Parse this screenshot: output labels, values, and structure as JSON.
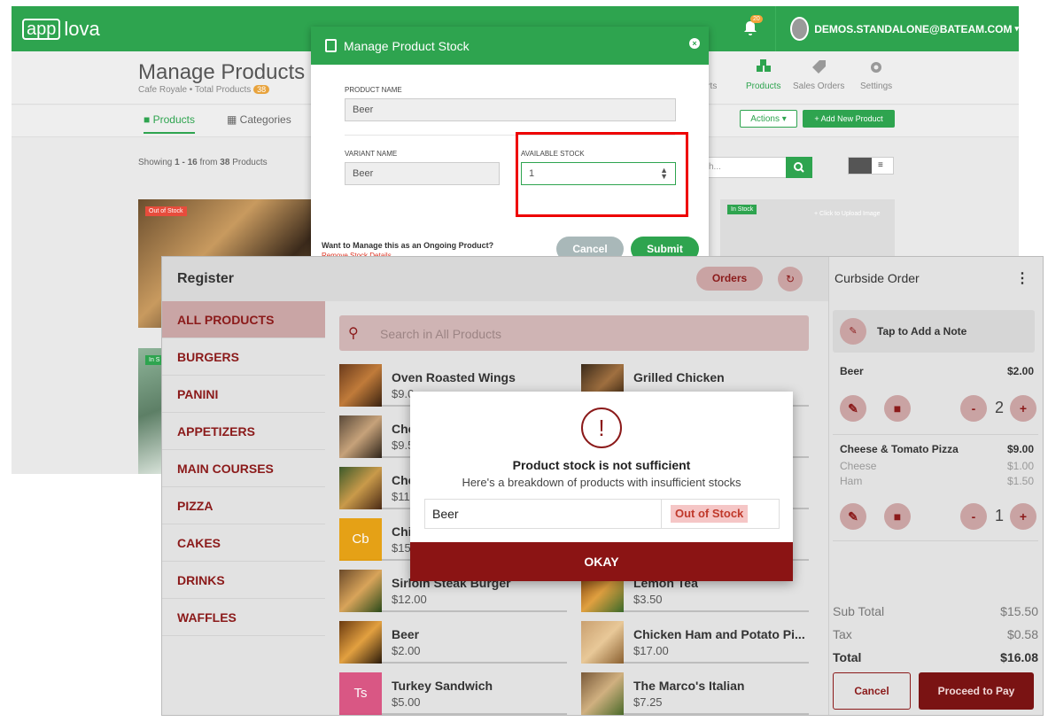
{
  "admin": {
    "logo_box": "app",
    "logo_text": "lova",
    "notif_count": "20",
    "user_email": "DEMOS.STANDALONE@BATEAM.COM",
    "user_caret": "▾",
    "page_title": "Manage Products",
    "page_sub": "Cafe Royale • Total Products",
    "total_products": "38",
    "nav": [
      "orts",
      "Products",
      "Sales Orders",
      "Settings"
    ],
    "tabs": {
      "products": "Products",
      "categories": "Categories"
    },
    "actions_label": "Actions ▾",
    "add_label": "+ Add New Product",
    "showing_pre": "Showing",
    "showing_range": "1 - 16",
    "showing_mid": "from",
    "showing_count": "38",
    "showing_post": "Products",
    "search_placeholder": "ch...",
    "out_of_stock": "Out of Stock",
    "in_stock": "In Stock",
    "in_stock_2": "In S",
    "upload": "+ Click to Upload Image"
  },
  "stock_modal": {
    "title": "Manage Product Stock",
    "product_name_label": "PRODUCT NAME",
    "product_name_value": "Beer",
    "variant_name_label": "VARIANT NAME",
    "variant_name_value": "Beer",
    "available_stock_label": "AVAILABLE STOCK",
    "available_stock_value": "1",
    "footer_question": "Want to Manage this as an Ongoing Product?",
    "footer_remove": "Remove Stock Details",
    "cancel": "Cancel",
    "submit": "Submit"
  },
  "pos": {
    "title": "Register",
    "orders": "Orders",
    "categories": [
      "ALL PRODUCTS",
      "BURGERS",
      "PANINI",
      "APPETIZERS",
      "MAIN COURSES",
      "PIZZA",
      "CAKES",
      "DRINKS",
      "WAFFLES"
    ],
    "search_placeholder": "Search in All Products",
    "products_left": [
      {
        "name": "Oven Roasted Wings",
        "price": "$9.0"
      },
      {
        "name": "Che",
        "price": "$9.5"
      },
      {
        "name": "Che",
        "price": "$11"
      },
      {
        "name": "Chi",
        "price": "$15",
        "initials": "Cb"
      },
      {
        "name": "Sirloin Steak Burger",
        "price": "$12.00"
      },
      {
        "name": "Beer",
        "price": "$2.00"
      },
      {
        "name": "Turkey Sandwich",
        "price": "$5.00",
        "initials": "Ts"
      }
    ],
    "products_right": [
      {
        "name": "Grilled Chicken",
        "price": ""
      },
      {
        "name": "",
        "price": ""
      },
      {
        "name": "",
        "price": ""
      },
      {
        "name": "",
        "price": ""
      },
      {
        "name": "Lemon Tea",
        "price": "$3.50"
      },
      {
        "name": "Chicken Ham and Potato Pi...",
        "price": "$17.00"
      },
      {
        "name": "The Marco's Italian",
        "price": "$7.25"
      }
    ],
    "cart": {
      "order_type": "Curbside Order",
      "menu": "⋮",
      "note": "Tap to Add a Note",
      "items": [
        {
          "name": "Beer",
          "price": "$2.00",
          "qty": "2",
          "mods": []
        },
        {
          "name": "Cheese & Tomato Pizza",
          "price": "$9.00",
          "qty": "1",
          "mods": [
            {
              "name": "Cheese",
              "price": "$1.00"
            },
            {
              "name": "Ham",
              "price": "$1.50"
            }
          ]
        }
      ],
      "subtotal_label": "Sub Total",
      "subtotal": "$15.50",
      "tax_label": "Tax",
      "tax": "$0.58",
      "total_label": "Total",
      "total": "$16.08",
      "cancel": "Cancel",
      "proceed": "Proceed to Pay"
    }
  },
  "alert": {
    "icon": "!",
    "title": "Product stock is not sufficient",
    "subtitle": "Here's a breakdown of products with insufficient stocks",
    "product": "Beer",
    "status": "Out of Stock",
    "okay": "OKAY"
  },
  "colors": {
    "green": "#2ea44f",
    "maroon": "#8b1a1a",
    "highlight": "#e00000"
  }
}
